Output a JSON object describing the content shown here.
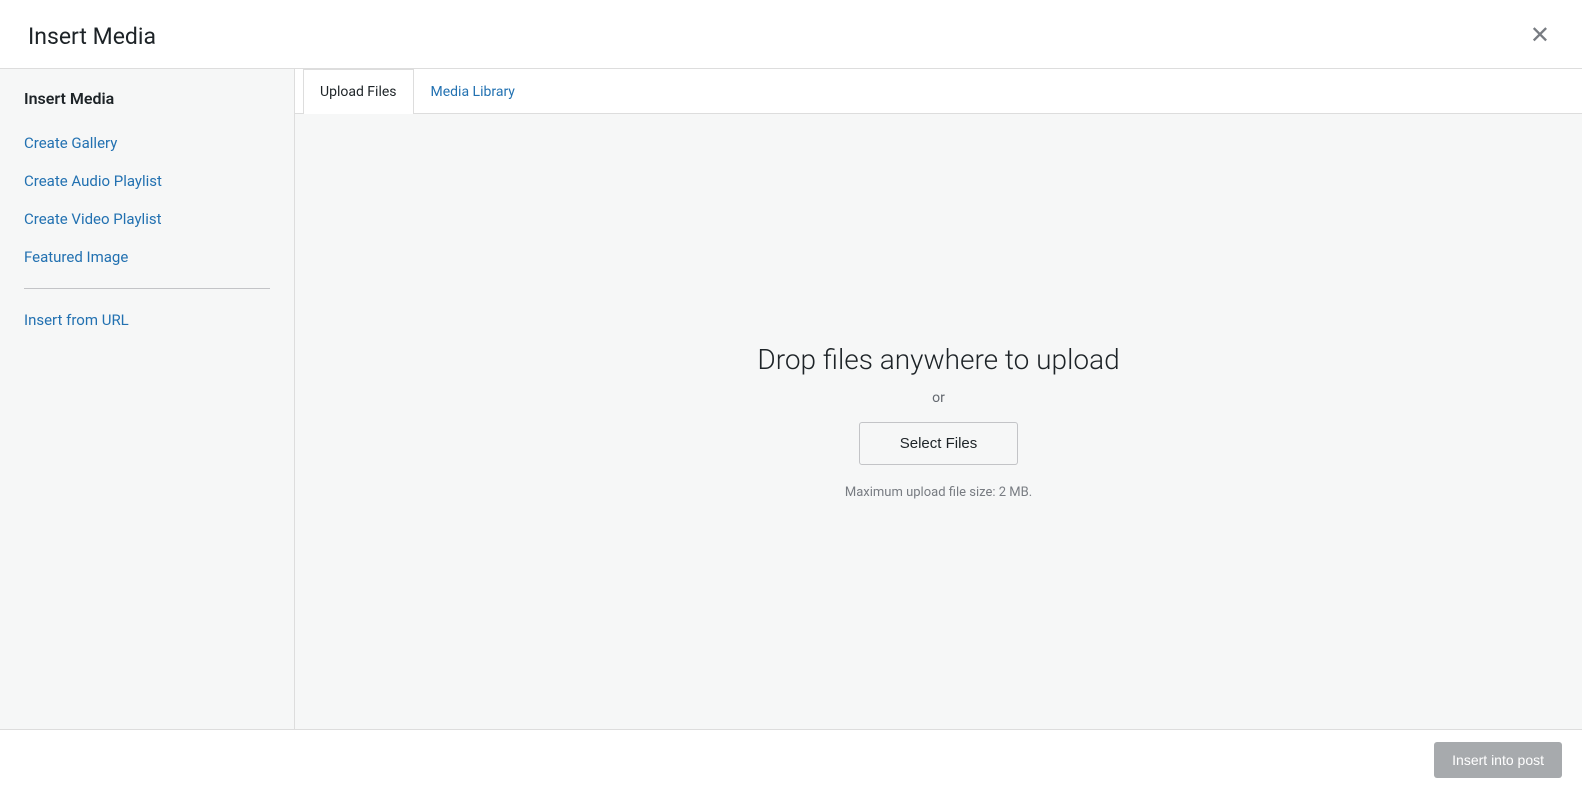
{
  "modal": {
    "title": "Insert Media",
    "close_label": "✕"
  },
  "sidebar": {
    "title": "Insert Media",
    "items": [
      {
        "id": "create-gallery",
        "label": "Create Gallery"
      },
      {
        "id": "create-audio-playlist",
        "label": "Create Audio Playlist"
      },
      {
        "id": "create-video-playlist",
        "label": "Create Video Playlist"
      },
      {
        "id": "featured-image",
        "label": "Featured Image"
      },
      {
        "id": "insert-from-url",
        "label": "Insert from URL"
      }
    ]
  },
  "tabs": [
    {
      "id": "upload-files",
      "label": "Upload Files",
      "active": true
    },
    {
      "id": "media-library",
      "label": "Media Library",
      "active": false
    }
  ],
  "upload": {
    "drop_text": "Drop files anywhere to upload",
    "or_text": "or",
    "select_button_label": "Select Files",
    "max_size_text": "Maximum upload file size: 2 MB."
  },
  "footer": {
    "insert_button_label": "Insert into post"
  }
}
